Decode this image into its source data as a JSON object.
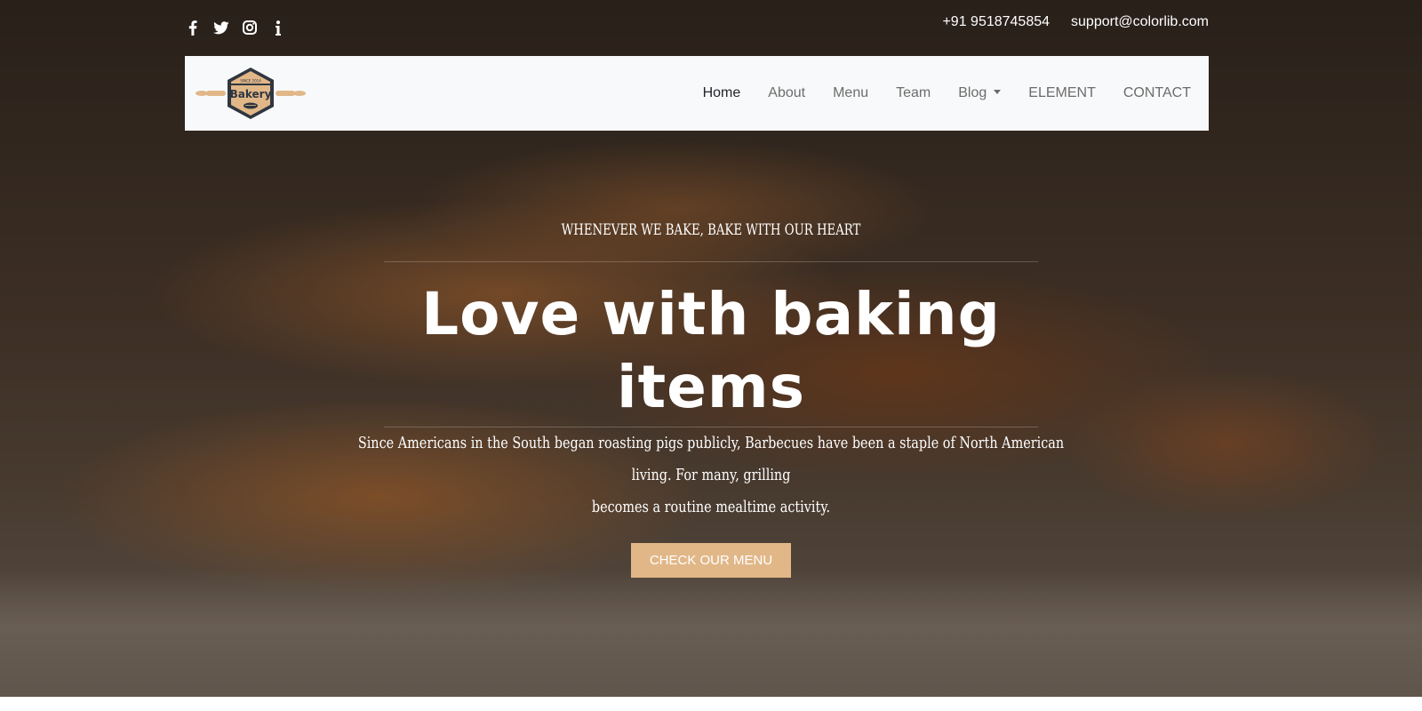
{
  "topbar": {
    "social": [
      {
        "icon": "facebook-icon"
      },
      {
        "icon": "twitter-icon"
      },
      {
        "icon": "instagram-icon"
      },
      {
        "icon": "info-icon"
      }
    ],
    "phone": "+91 9518745854",
    "email": "support@colorlib.com"
  },
  "navbar": {
    "logo_text": "Bakery",
    "logo_small_text": "SINCE 2014",
    "links": [
      {
        "label": "Home",
        "active": true
      },
      {
        "label": "About"
      },
      {
        "label": "Menu"
      },
      {
        "label": "Team"
      },
      {
        "label": "Blog",
        "dropdown": true
      },
      {
        "label": "ELEMENT"
      },
      {
        "label": "CONTACT"
      }
    ]
  },
  "hero": {
    "tagline": "WHENEVER WE BAKE, BAKE WITH OUR HEART",
    "headline": "Love with baking items",
    "description_line1": "Since Americans in the South began roasting pigs publicly, Barbecues have been a staple of North American living. For many, grilling",
    "description_line2": "becomes a routine mealtime activity.",
    "cta_label": "CHECK OUR MENU"
  },
  "colors": {
    "accent": "#e1b788",
    "navbar_bg": "#f8f9fa",
    "nav_text": "#6c6c6c",
    "nav_active": "#212529"
  }
}
